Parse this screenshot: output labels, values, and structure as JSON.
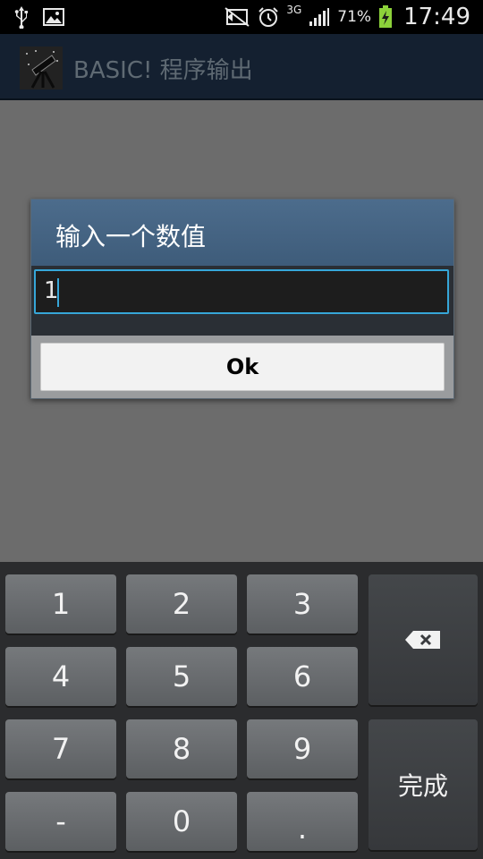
{
  "status_bar": {
    "network_type": "3G",
    "battery_percent": "71%",
    "time": "17:49",
    "icons": [
      "usb-icon",
      "image-icon",
      "mute-icon",
      "alarm-icon",
      "signal-icon",
      "battery-charging-icon"
    ]
  },
  "action_bar": {
    "title": "BASIC! 程序输出",
    "icon": "telescope-icon"
  },
  "dialog": {
    "title": "输入一个数值",
    "input_value": "1",
    "ok_label": "Ok"
  },
  "keyboard": {
    "keys": [
      "1",
      "2",
      "3",
      "4",
      "5",
      "6",
      "7",
      "8",
      "9",
      "-",
      "0",
      "."
    ],
    "backspace": "backspace-icon",
    "done_label": "完成"
  },
  "colors": {
    "accent": "#36a6d8",
    "dialog_header": "#4a6a8a",
    "background": "#6c6c6c"
  }
}
